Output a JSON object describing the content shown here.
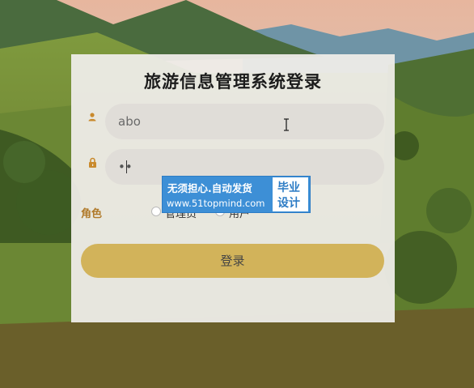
{
  "login": {
    "title": "旅游信息管理系统登录",
    "username_value": "abo",
    "password_value": "••",
    "role_label": "角色",
    "role_options": [
      "管理员",
      "用户"
    ],
    "submit_label": "登录"
  },
  "watermark": {
    "line1": "无须担心.自动发货",
    "line2": "www.51topmind.com",
    "badge_line1": "毕业",
    "badge_line2": "设计"
  },
  "colors": {
    "accent": "#d2b35a",
    "icon": "#c98a2c",
    "field_bg": "#e0ddd8",
    "card_bg": "#eeece8",
    "watermark_bg": "#3d8fd6"
  },
  "icons": [
    "user-icon",
    "lock-icon",
    "text-cursor-icon"
  ]
}
